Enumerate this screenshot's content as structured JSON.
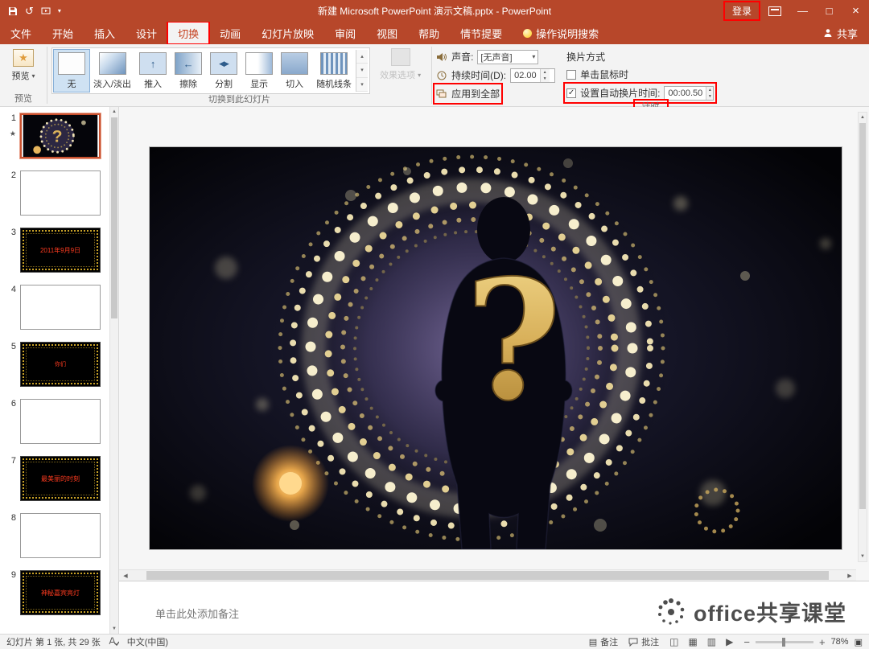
{
  "titlebar": {
    "title": "新建 Microsoft PowerPoint 演示文稿.pptx  -  PowerPoint",
    "login_label": "登录"
  },
  "tabs": [
    "文件",
    "开始",
    "插入",
    "设计",
    "切换",
    "动画",
    "幻灯片放映",
    "审阅",
    "视图",
    "帮助",
    "情节提要",
    "操作说明搜索"
  ],
  "share_label": "共享",
  "ribbon": {
    "group_labels": {
      "preview": "预览",
      "transition": "切换到此幻灯片",
      "timing": "计时"
    },
    "preview_label": "预览",
    "gallery": [
      {
        "label": "无",
        "icon": "none-transition-icon",
        "selected": true
      },
      {
        "label": "淡入/淡出",
        "icon": "fade-transition-icon"
      },
      {
        "label": "推入",
        "icon": "push-transition-icon"
      },
      {
        "label": "擦除",
        "icon": "wipe-transition-icon"
      },
      {
        "label": "分割",
        "icon": "split-transition-icon"
      },
      {
        "label": "显示",
        "icon": "reveal-transition-icon"
      },
      {
        "label": "切入",
        "icon": "cut-transition-icon"
      },
      {
        "label": "随机线条",
        "icon": "random-bars-transition-icon"
      }
    ],
    "effect_options_label": "效果选项",
    "timing": {
      "sound_label": "声音:",
      "sound_value": "[无声音]",
      "duration_label": "持续时间(D):",
      "duration_value": "02.00",
      "apply_all_label": "应用到全部",
      "advance_heading": "换片方式",
      "on_click_label": "单击鼠标时",
      "on_click_checked": false,
      "auto_advance_label": "设置自动换片时间:",
      "auto_advance_value": "00:00.50",
      "auto_advance_checked": true
    }
  },
  "slides_panel": [
    {
      "num": "1",
      "starred": true,
      "kind": "main"
    },
    {
      "num": "2",
      "kind": "blank"
    },
    {
      "num": "3",
      "kind": "gold",
      "text": "2011年9月9日"
    },
    {
      "num": "4",
      "kind": "blank"
    },
    {
      "num": "5",
      "kind": "gold",
      "text": "你们"
    },
    {
      "num": "6",
      "kind": "blank"
    },
    {
      "num": "7",
      "kind": "gold",
      "text": "最美丽的时刻"
    },
    {
      "num": "8",
      "kind": "blank"
    },
    {
      "num": "9",
      "kind": "gold",
      "text": "神秘嘉宾亮灯"
    }
  ],
  "slide": {
    "question_mark": "?"
  },
  "notes": {
    "placeholder": "单击此处添加备注",
    "watermark": "office共享课堂"
  },
  "statusbar": {
    "slide_info": "幻灯片 第 1 张, 共 29 张",
    "language": "中文(中国)",
    "notes_label": "备注",
    "comments_label": "批注",
    "zoom_level": "78%"
  },
  "icons": {
    "undo": "↺",
    "dropdown": "▾",
    "minimize": "—",
    "maximize": "□",
    "close": "×",
    "check": "✓",
    "star": "★",
    "preview_star": "★",
    "push_arrow": "↑",
    "wipe_arrow": "←",
    "split_arrows": "◀▶",
    "spin_up": "▲",
    "spin_down": "▼",
    "scroll_up": "▲",
    "scroll_down": "▼",
    "scroll_left": "◀",
    "scroll_right": "▶",
    "gallery_up": "▴",
    "gallery_down": "▾",
    "gallery_more": "▾",
    "view_normal": "◫",
    "view_sorter": "▦",
    "view_reading": "▥",
    "view_slideshow": "▶",
    "zoom_out": "−",
    "zoom_in": "+",
    "fit_window": "▣",
    "notes_glyph": "▤"
  },
  "colors": {
    "titlebar": "#b7472a",
    "annotation": "#ff0000",
    "accent": "#c43e1c",
    "gold": "#d8b05a"
  }
}
